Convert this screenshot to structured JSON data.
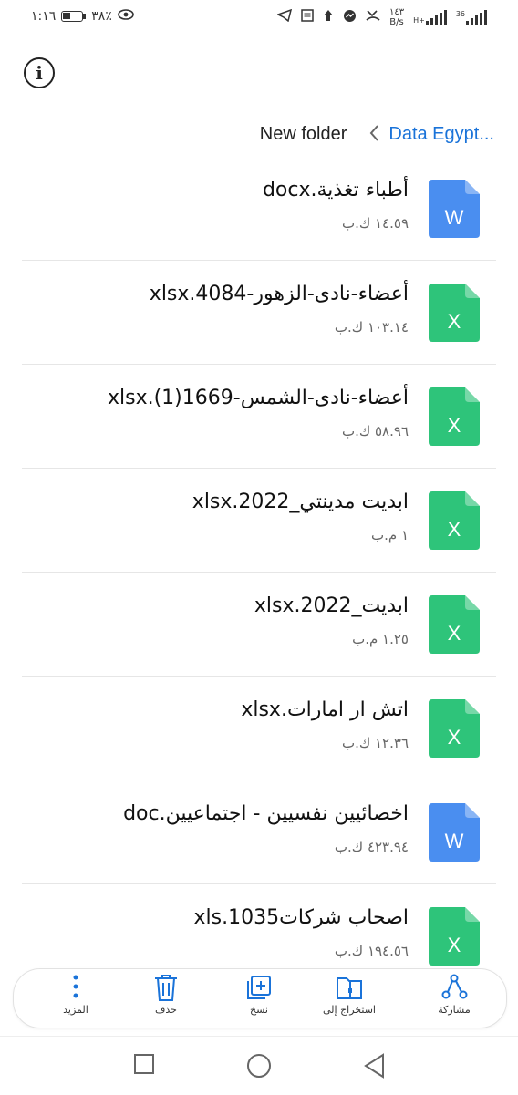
{
  "status_bar": {
    "time": "١:١٦",
    "battery_pct": "٣٨٪",
    "net_speed_value": "١٤٣",
    "net_speed_unit": "B/s",
    "signal1_label": "H+",
    "signal2_label": "36"
  },
  "header": {
    "info_label": "i",
    "breadcrumb_parent": "Data Egypt...",
    "breadcrumb_current": "New folder"
  },
  "files": [
    {
      "name": "أطباء تغذية.docx",
      "size": "١٤.٥٩ ك.ب",
      "type": "word",
      "letter": "W"
    },
    {
      "name": "أعضاء-نادى-الزهور-4084.xlsx",
      "size": "١٠٣.١٤ ك.ب",
      "type": "excel",
      "letter": "X"
    },
    {
      "name": "أعضاء-نادى-الشمس-1669(1).xlsx",
      "size": "٥٨.٩٦ ك.ب",
      "type": "excel",
      "letter": "X"
    },
    {
      "name": "ابديت مدينتي_2022.xlsx",
      "size": "١ م.ب",
      "type": "excel",
      "letter": "X"
    },
    {
      "name": "ابديت_2022.xlsx",
      "size": "١.٢٥ م.ب",
      "type": "excel",
      "letter": "X"
    },
    {
      "name": "اتش ار امارات.xlsx",
      "size": "١٢.٣٦ ك.ب",
      "type": "excel",
      "letter": "X"
    },
    {
      "name": "اخصائيين نفسيين - اجتماعيين.doc",
      "size": "٤٢٣.٩٤ ك.ب",
      "type": "word",
      "letter": "W"
    },
    {
      "name": "اصحاب شركات1035.xls",
      "size": "١٩٤.٥٦ ك.ب",
      "type": "excel",
      "letter": "X"
    }
  ],
  "actions": {
    "share": "مشاركة",
    "extract": "استخراج إلى",
    "copy": "نسخ",
    "delete": "حذف",
    "more": "المزيد"
  },
  "colors": {
    "accent": "#1a73d9",
    "word": "#4a8ef0",
    "excel": "#2ec47a"
  }
}
